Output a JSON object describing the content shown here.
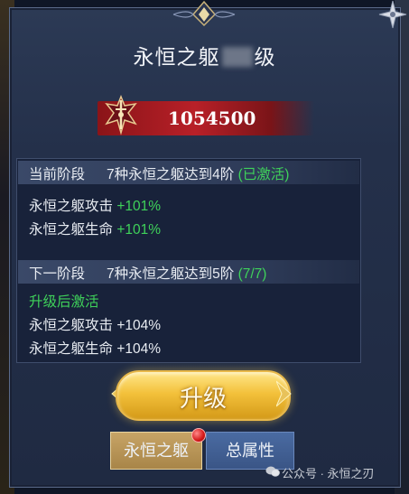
{
  "dialog": {
    "title_prefix": "永恒之躯",
    "title_suffix": "级"
  },
  "power": {
    "value": "1054500"
  },
  "current_stage": {
    "label": "当前阶段",
    "condition": "7种永恒之躯达到4阶",
    "status": "(已激活)",
    "attrs": [
      {
        "name": "永恒之躯攻击",
        "value": "+101%"
      },
      {
        "name": "永恒之躯生命",
        "value": "+101%"
      }
    ]
  },
  "next_stage": {
    "label": "下一阶段",
    "condition": "7种永恒之躯达到5阶",
    "progress": "(7/7)",
    "activate_note": "升级后激活",
    "attrs": [
      {
        "name": "永恒之躯攻击",
        "value": "+104%"
      },
      {
        "name": "永恒之躯生命",
        "value": "+104%"
      }
    ]
  },
  "actions": {
    "upgrade_label": "升级"
  },
  "tabs": [
    {
      "label": "永恒之躯"
    },
    {
      "label": "总属性"
    }
  ],
  "watermark": {
    "text": "公众号 · 永恒之刃"
  },
  "colors": {
    "active_green": "#3fd25a",
    "banner_red": "#b82028",
    "button_gold": "#f3c13b"
  }
}
